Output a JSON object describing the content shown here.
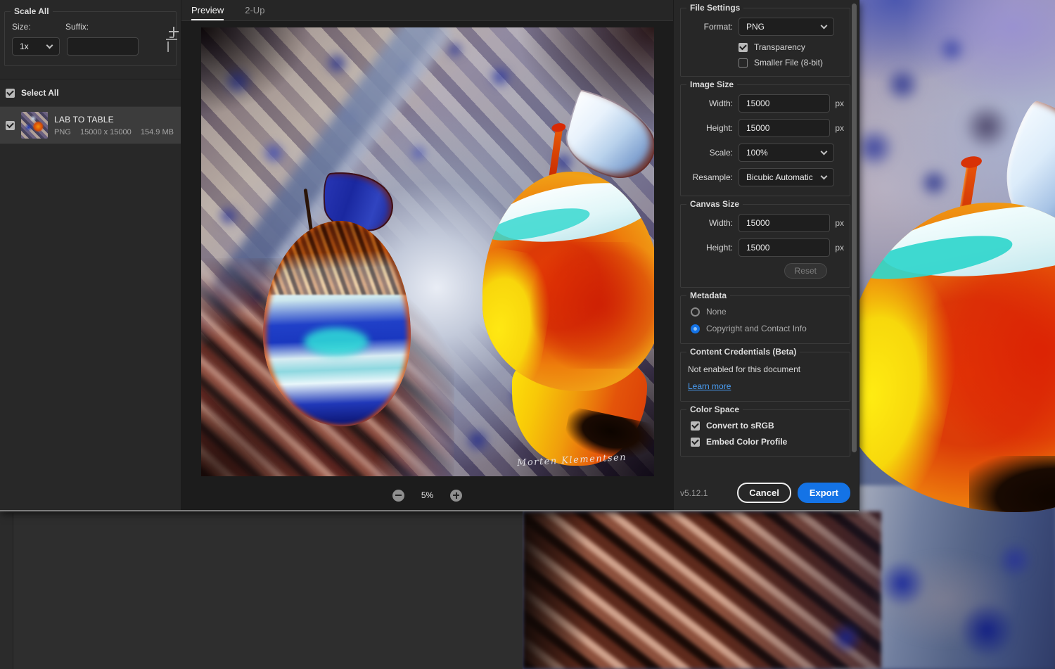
{
  "colors": {
    "accent_blue": "#1473e6",
    "link_blue": "#4ba0f8",
    "panel_bg": "#272727",
    "canvas_bg": "#1c1c1c",
    "pasteboard": "#2e2e2e",
    "selected_row": "#3c3c3c"
  },
  "left_panel": {
    "scale_all_legend": "Scale All",
    "size_label": "Size:",
    "suffix_label": "Suffix:",
    "size_value": "1x",
    "suffix_value": "",
    "select_all_label": "Select All",
    "select_all_checked": true,
    "file_item": {
      "checked": true,
      "name": "LAB TO TABLE",
      "format": "PNG",
      "dimensions": "15000 x 15000",
      "filesize": "154.9 MB"
    }
  },
  "preview": {
    "tab_preview": "Preview",
    "tab_2up": "2-Up",
    "active_tab": "Preview",
    "zoom_level": "5%",
    "signature": "Morten Klementsen"
  },
  "right_panel": {
    "file_settings": {
      "legend": "File Settings",
      "format_label": "Format:",
      "format_value": "PNG",
      "transparency_label": "Transparency",
      "transparency_checked": true,
      "smaller_file_label": "Smaller File (8-bit)",
      "smaller_file_checked": false
    },
    "image_size": {
      "legend": "Image Size",
      "width_label": "Width:",
      "width_value": "15000",
      "height_label": "Height:",
      "height_value": "15000",
      "unit": "px",
      "scale_label": "Scale:",
      "scale_value": "100%",
      "resample_label": "Resample:",
      "resample_value": "Bicubic Automatic"
    },
    "canvas_size": {
      "legend": "Canvas Size",
      "width_label": "Width:",
      "width_value": "15000",
      "height_label": "Height:",
      "height_value": "15000",
      "unit": "px",
      "reset_label": "Reset",
      "reset_enabled": false
    },
    "metadata": {
      "legend": "Metadata",
      "none_label": "None",
      "none_selected": false,
      "copyright_label": "Copyright and Contact Info",
      "copyright_selected": true
    },
    "content_credentials": {
      "legend": "Content Credentials (Beta)",
      "status_text": "Not enabled for this document",
      "learn_more_label": "Learn more"
    },
    "color_space": {
      "legend": "Color Space",
      "convert_label": "Convert to sRGB",
      "convert_checked": true,
      "embed_label": "Embed Color Profile",
      "embed_checked": true
    },
    "footer": {
      "version": "v5.12.1",
      "cancel_label": "Cancel",
      "export_label": "Export"
    }
  }
}
